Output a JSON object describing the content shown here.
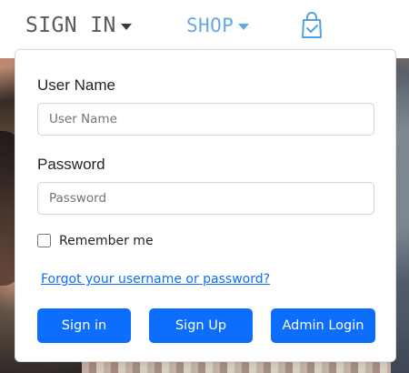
{
  "nav": {
    "sign_in_label": "SIGN IN",
    "shop_label": "SHOP",
    "colors": {
      "sign_in": "#5a5a5a",
      "shop": "#64a8e6"
    },
    "icons": {
      "sign_in_caret": "chevron-down-icon",
      "shop_caret": "chevron-down-icon",
      "bag": "shopping-bag-check-icon"
    }
  },
  "login_form": {
    "username": {
      "label": "User Name",
      "placeholder": "User Name",
      "value": ""
    },
    "password": {
      "label": "Password",
      "placeholder": "Password",
      "value": ""
    },
    "remember_me": {
      "label": "Remember me",
      "checked": false
    },
    "forgot_link": "Forgot your username or password?",
    "buttons": {
      "sign_in": "Sign in",
      "sign_up": "Sign Up",
      "admin_login": "Admin Login"
    },
    "colors": {
      "primary": "#0d6efd",
      "link": "#0d6efd",
      "text": "#212529",
      "border": "#ced4da"
    }
  }
}
